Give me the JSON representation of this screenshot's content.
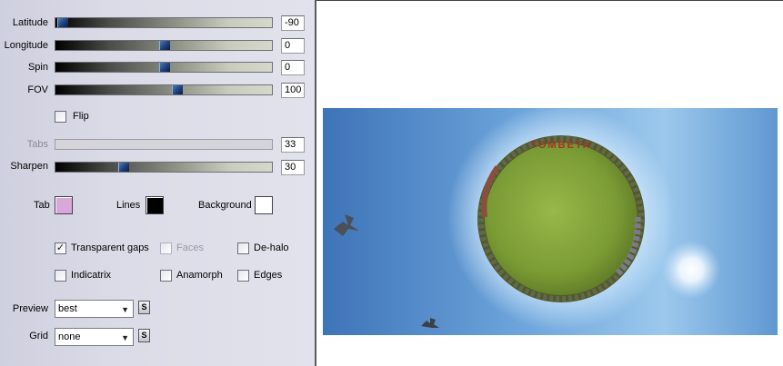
{
  "sliders": [
    {
      "id": "latitude",
      "label": "Latitude",
      "value": "-90",
      "fraction": 0.03,
      "disabled": false
    },
    {
      "id": "longitude",
      "label": "Longitude",
      "value": "0",
      "fraction": 0.5,
      "disabled": false
    },
    {
      "id": "spin",
      "label": "Spin",
      "value": "0",
      "fraction": 0.5,
      "disabled": false
    },
    {
      "id": "fov",
      "label": "FOV",
      "value": "100",
      "fraction": 0.56,
      "disabled": false
    }
  ],
  "flip": {
    "label": "Flip",
    "checked": false
  },
  "tabs_slider": {
    "label": "Tabs",
    "value": "33",
    "disabled": true
  },
  "sharpen_slider": {
    "label": "Sharpen",
    "value": "30",
    "fraction": 0.31
  },
  "colors": {
    "tab": {
      "label": "Tab",
      "color": "#d9a8d9"
    },
    "lines": {
      "label": "Lines",
      "color": "#000000"
    },
    "background": {
      "label": "Background",
      "color": "#ffffff"
    }
  },
  "options": {
    "transparent_gaps": {
      "label": "Transparent gaps",
      "checked": true,
      "disabled": false
    },
    "faces": {
      "label": "Faces",
      "checked": false,
      "disabled": true
    },
    "de_halo": {
      "label": "De-halo",
      "checked": false,
      "disabled": false
    },
    "indicatrix": {
      "label": "Indicatrix",
      "checked": false,
      "disabled": false
    },
    "anamorph": {
      "label": "Anamorph",
      "checked": false,
      "disabled": false
    },
    "edges": {
      "label": "Edges",
      "checked": false,
      "disabled": false
    }
  },
  "preview": {
    "label": "Preview",
    "selected": "best",
    "button": "S"
  },
  "grid": {
    "label": "Grid",
    "selected": "none",
    "button": "S"
  },
  "canvas": {
    "sign_text": "TOMBETA",
    "bird_icon": "bird-icon"
  }
}
